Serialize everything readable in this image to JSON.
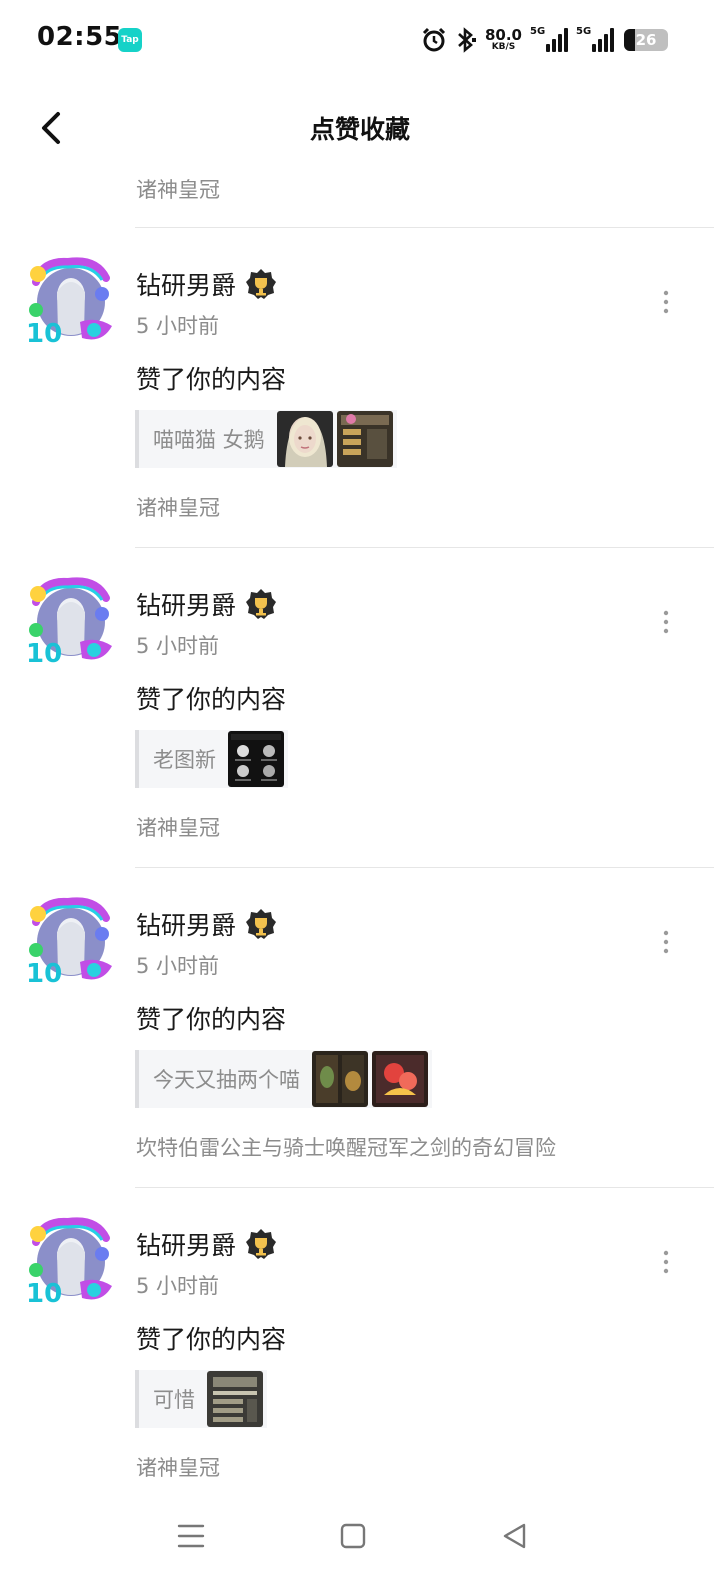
{
  "status": {
    "time": "02:55",
    "app_badge": "Tap",
    "net_speed_value": "80.0",
    "net_speed_unit": "KB/S",
    "sim1_label": "5G",
    "sim2_label": "5G",
    "battery_percent": "26",
    "battery_level": 0.26
  },
  "header": {
    "title": "点赞收藏",
    "back_icon": "chevron-left-icon"
  },
  "top_source": "诸神皇冠",
  "items": [
    {
      "user": "钻研男爵",
      "time": "5 小时前",
      "action": "赞了你的内容",
      "preview_text": "喵喵猫 女鹅",
      "thumb_count": 2,
      "source": "诸神皇冠"
    },
    {
      "user": "钻研男爵",
      "time": "5 小时前",
      "action": "赞了你的内容",
      "preview_text": "老图新",
      "thumb_count": 1,
      "source": "诸神皇冠"
    },
    {
      "user": "钻研男爵",
      "time": "5 小时前",
      "action": "赞了你的内容",
      "preview_text": "今天又抽两个喵",
      "thumb_count": 2,
      "source": "坎特伯雷公主与骑士唤醒冠军之剑的奇幻冒险"
    },
    {
      "user": "钻研男爵",
      "time": "5 小时前",
      "action": "赞了你的内容",
      "preview_text": "可惜",
      "thumb_count": 1,
      "source": "诸神皇冠"
    }
  ],
  "thumb_images": [
    [
      "thumb-portrait-girl",
      "thumb-game-screen"
    ],
    [
      "thumb-before-after-grid"
    ],
    [
      "thumb-dark-card",
      "thumb-red-character"
    ],
    [
      "thumb-game-dialog"
    ]
  ],
  "nav": {
    "menu_icon": "menu-icon",
    "home_icon": "square-home-icon",
    "back_icon": "triangle-back-icon"
  },
  "colors": {
    "text_primary": "#1a1a1a",
    "text_secondary": "#8c8c8c",
    "divider": "#e6e6e6",
    "tap_brand": "#16d2c8"
  }
}
